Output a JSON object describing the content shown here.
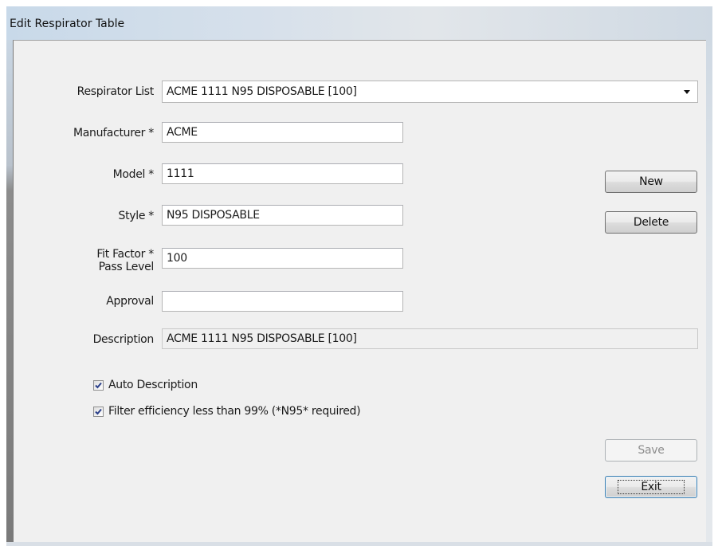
{
  "window": {
    "title": "Edit Respirator Table"
  },
  "form": {
    "respirator_list_label": "Respirator List",
    "respirator_list_value": "ACME 1111 N95 DISPOSABLE [100]",
    "manufacturer_label": "Manufacturer *",
    "manufacturer_value": "ACME",
    "model_label": "Model *",
    "model_value": "1111",
    "style_label": "Style *",
    "style_value": "N95 DISPOSABLE",
    "fit_factor_label_line1": "Fit Factor *",
    "fit_factor_label_line2": "Pass Level",
    "fit_factor_value": "100",
    "approval_label": "Approval",
    "approval_value": "",
    "description_label": "Description",
    "description_value": "ACME 1111 N95 DISPOSABLE [100]"
  },
  "options": {
    "auto_description_label": "Auto Description",
    "auto_description_checked": true,
    "filter_efficiency_label": "Filter efficiency less than 99% (*N95* required)",
    "filter_efficiency_checked": true
  },
  "buttons": {
    "new_label": "New",
    "delete_label": "Delete",
    "save_label": "Save",
    "exit_label": "Exit"
  }
}
